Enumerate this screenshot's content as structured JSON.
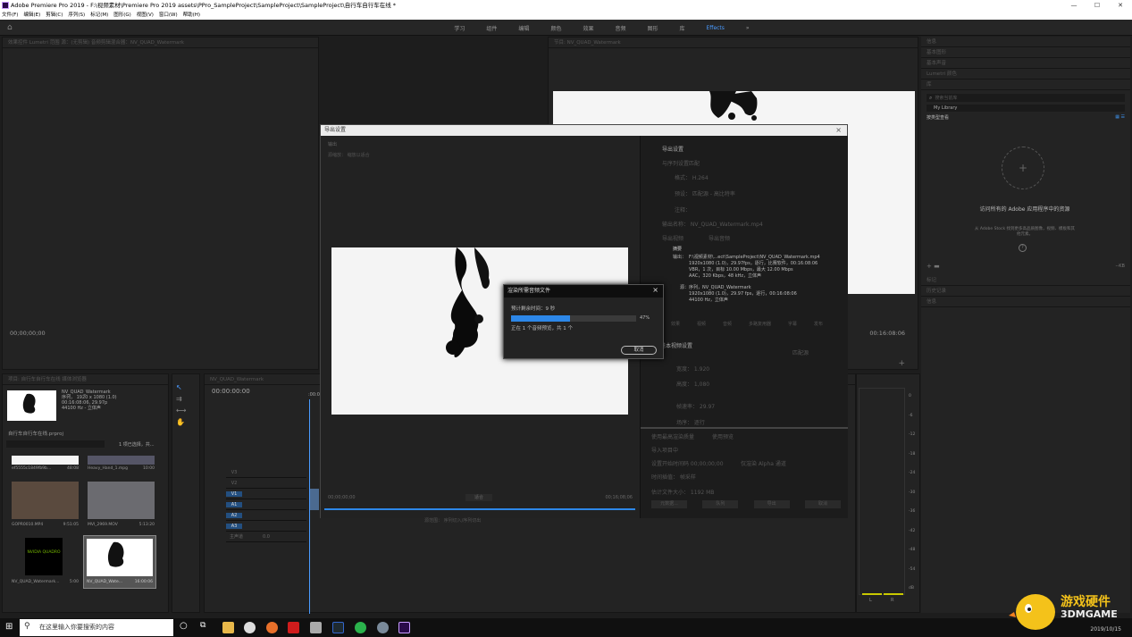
{
  "window": {
    "title": "Adobe Premiere Pro 2019 - F:\\视频素材\\Premiere Pro 2019 assets\\PPro_SampleProject\\SampleProject\\SampleProject\\自行车自行车在线 *",
    "min": "—",
    "max": "☐",
    "close": "✕"
  },
  "menu": [
    "文件(F)",
    "编辑(E)",
    "剪辑(C)",
    "序列(S)",
    "标记(M)",
    "图形(G)",
    "视图(V)",
    "窗口(W)",
    "帮助(H)"
  ],
  "workspaces": [
    "学习",
    "组件",
    "编辑",
    "颜色",
    "效果",
    "音频",
    "图形",
    "库",
    "Effects"
  ],
  "workspace_more": "»",
  "left_monitor": {
    "tabs": "效果控件   Lumetri 范围   源：(无剪辑)   音频剪辑混合器：NV_QUAD_Watermark",
    "timecode": "00;00;00;00"
  },
  "program_monitor": {
    "tab": "节目: NV_QUAD_Watermark",
    "timecode": "00:16:08:06"
  },
  "right_panel": {
    "rows": [
      "信息",
      "基本图形",
      "基本声音",
      "Lumetri 颜色",
      "库"
    ],
    "search_placeholder": "搜索当前库",
    "library": "My Library",
    "view_label": "按类型查看",
    "plus": "+",
    "title": "访问所有的 Adobe 应用程序中的资源",
    "desc": "从 Adobe Stock 找到更多高品质图像，视频、模板和其他元素。",
    "help": "?",
    "kb": "--KB",
    "bottom_rows": [
      "标记",
      "历史记录",
      "信息"
    ]
  },
  "export": {
    "title": "导出设置",
    "close": "×",
    "left_tab": "输出",
    "source_scaling": "源缩放：  缩放以适合",
    "match": "与序列设置匹配",
    "format": "格式：  H.264",
    "preset": "预设：  匹配源 - 高比特率",
    "comments": "注释：",
    "output_name": "输出名称：  NV_QUAD_Watermark.mp4",
    "export_video": "导出视频",
    "export_audio": "导出音频",
    "summary_label": "摘要",
    "output_label": "输出：",
    "output_lines": [
      "F:\\视频素材\\...ect\\SampleProject\\NV_QUAD_Watermark.mp4",
      "1920x1080 (1.0)，29.97fps，逐行，比赛软件，00:16:08:06",
      "VBR，1 次，目标 10.00 Mbps，最大 12.00 Mbps",
      "AAC，320 Kbps，48 kHz，立体声"
    ],
    "source_label": "源：",
    "source_lines": [
      "序列，NV_QUAD_Watermark",
      "1920x1080 (1.0)，29.97 fps，逐行，00:16:08:06",
      "44100 Hz，立体声"
    ],
    "tabs": [
      "效果",
      "视频",
      "音频",
      "多路复用器",
      "字幕",
      "发布"
    ],
    "basic_video": "基本视频设置",
    "match_source_btn": "匹配源",
    "width": "宽度：  1.920",
    "height": "高度：  1,080",
    "framerate": "帧速率：  29.97",
    "field_order": "场序：  逐行",
    "max_render": "使用最高渲染质量",
    "use_previews": "使用预览",
    "import_project": "导入项目中",
    "set_start_tc": "设置开始时间码  00;00;00;00",
    "render_alpha": "仅渲染 Alpha 通道",
    "interpolation": "时间插值：  帧采样",
    "file_size": "估计文件大小：  1192 MB",
    "buttons": [
      "元数据...",
      "队列",
      "导出",
      "取消"
    ],
    "left_timecode": "00;00;00;00",
    "right_timecode": "00;16;08;06",
    "fit": "适合",
    "source_range": "源范围：  序列切入/序列切出"
  },
  "progress": {
    "title": "渲染所需音频文件",
    "close": "×",
    "eta": "预计剩余时间：9 秒",
    "percent_text": "47%",
    "status": "正在 1 个音频预览，共 1 个",
    "cancel": "取消",
    "value": 0.47
  },
  "project": {
    "tabs": "项目: 自行车自行车在线   媒体浏览器",
    "clip_name": "NV_QUAD_Watermark",
    "clip_info": [
      "序列， 1920 x 1080 (1.0)",
      "00:16:08:06, 29.97p",
      "44100 Hz - 立体声"
    ],
    "project_file": "自行车自行车在线.prproj",
    "selection": "1 项已选择，共...",
    "items": [
      {
        "name": "ef5555c1849fb9b...",
        "dur": "48:08"
      },
      {
        "name": "Heavy_Hand_1.mpg",
        "dur": "10:00"
      },
      {
        "name": "GOPR0010.MP4",
        "dur": "9:51:05"
      },
      {
        "name": "MVI_2969.MOV",
        "dur": "5:13:20"
      },
      {
        "name": "NV_QUAD_Watermark...",
        "dur": "5:00"
      },
      {
        "name": "NV_QUAD_Wate...",
        "dur": "16:00:06"
      }
    ],
    "nvidia_label": "NVIDIA QUADRO"
  },
  "timeline": {
    "tab": "NV_QUAD_Watermark",
    "timecode": "00:00:00:00",
    "ruler_start": ":00:00",
    "tracks": [
      "V3",
      "V2",
      "V1",
      "A1",
      "A2",
      "A3"
    ],
    "master": "主声道",
    "master_val": "0.0"
  },
  "meters": {
    "ticks": [
      "0",
      "-6",
      "-12",
      "-18",
      "-24",
      "-30",
      "-36",
      "-42",
      "-48",
      "-54",
      "dB"
    ],
    "lr": [
      "L",
      "R"
    ]
  },
  "taskbar": {
    "search": "在这里输入你要搜索的内容",
    "date": "2019/10/15"
  },
  "watermark": {
    "line1": "游戏硬件",
    "line2": "3DMGAME"
  }
}
